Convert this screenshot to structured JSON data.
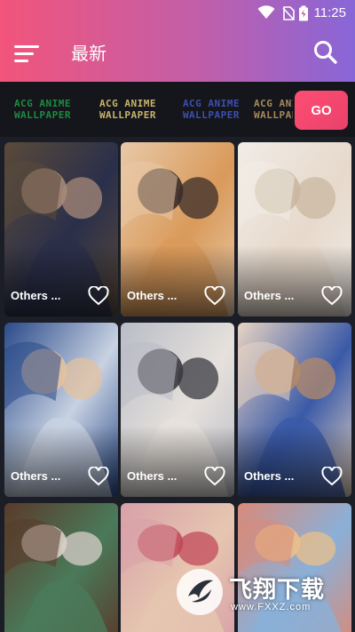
{
  "status_bar": {
    "time": "11:25"
  },
  "header": {
    "title": "最新"
  },
  "categories": [
    {
      "line1": "ACG ANIME",
      "line2": "WALLPAPER",
      "color": "#1f8a3e"
    },
    {
      "line1": "ACG ANIME",
      "line2": "WALLPAPER",
      "color": "#c8b46a"
    },
    {
      "line1": "ACG ANIME",
      "line2": "WALLPAPER",
      "color": "#3d4fb0"
    },
    {
      "line1": "ACG ANIME",
      "line2": "WALLPAPER",
      "color": "#a6895a"
    }
  ],
  "go_button": {
    "label": "GO"
  },
  "cards": [
    {
      "label": "Others ...",
      "palette": [
        "#5a4a3a",
        "#a88a7a",
        "#2a2f4a"
      ]
    },
    {
      "label": "Others ...",
      "palette": [
        "#e9c9a8",
        "#3a2c2a",
        "#d99a5a"
      ]
    },
    {
      "label": "Others ...",
      "palette": [
        "#f1ece6",
        "#c9b7a0",
        "#e7d9cc"
      ]
    },
    {
      "label": "Others ...",
      "palette": [
        "#2a4a8a",
        "#e3c1a0",
        "#c8d2e2"
      ]
    },
    {
      "label": "Others ...",
      "palette": [
        "#b9bcc7",
        "#3a3a40",
        "#e6e1dc"
      ]
    },
    {
      "label": "Others ...",
      "palette": [
        "#e8d4c2",
        "#b48a6a",
        "#3a5aa8"
      ]
    },
    {
      "label": "",
      "palette": [
        "#5a3a2a",
        "#d9cfc9",
        "#4a7a5a"
      ]
    },
    {
      "label": "",
      "palette": [
        "#d8a0a8",
        "#c24a5a",
        "#e6c6b0"
      ]
    },
    {
      "label": "",
      "palette": [
        "#d98a7a",
        "#e9c08a",
        "#8ab0d8"
      ]
    }
  ],
  "watermark": {
    "text": "飞翔下载",
    "url": "www.FXXZ.com"
  },
  "accent": "#f2547b"
}
